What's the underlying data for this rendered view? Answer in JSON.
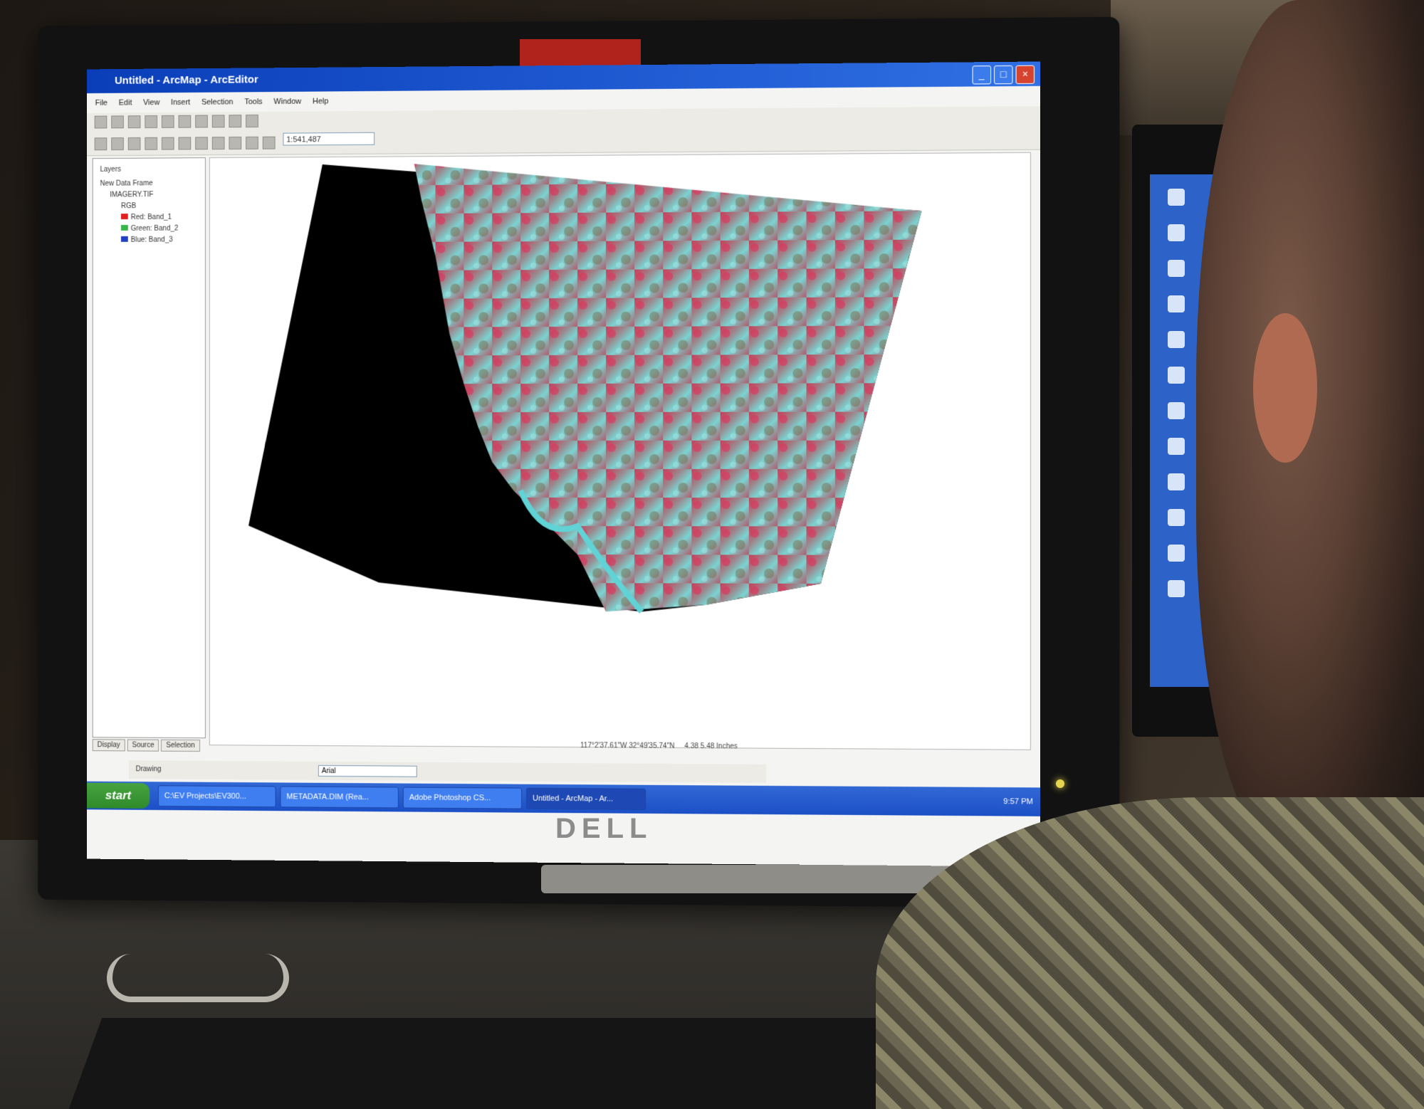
{
  "window": {
    "title": "Untitled - ArcMap - ArcEditor",
    "buttons": [
      "_",
      "□",
      "×"
    ]
  },
  "menu": [
    "File",
    "Edit",
    "View",
    "Insert",
    "Selection",
    "Tools",
    "Window",
    "Help"
  ],
  "toolbar": {
    "scale": "1:541,487"
  },
  "toc": {
    "root": "Layers",
    "frame": "New Data Frame",
    "layer": "IMAGERY.TIF",
    "rgb_label": "RGB",
    "bands": [
      {
        "label": "Red: Band_1",
        "color": "#e02020"
      },
      {
        "label": "Green: Band_2",
        "color": "#39b54a"
      },
      {
        "label": "Blue: Band_3",
        "color": "#2040c0"
      }
    ],
    "tabs": [
      "Display",
      "Source",
      "Selection"
    ]
  },
  "status": {
    "coords": "117°2'37.61\"W 32°49'35.74\"N",
    "page": "4.38 5.48 Inches"
  },
  "drawing": {
    "label": "Drawing",
    "font": "Arial",
    "size": "10"
  },
  "taskbar": {
    "start": "start",
    "items": [
      "C:\\EV Projects\\EV300...",
      "METADATA.DIM (Rea...",
      "Adobe Photoshop CS...",
      "Untitled - ArcMap - Ar..."
    ],
    "clock": "9:57 PM"
  },
  "brand": "DELL",
  "colors": {
    "xp_blue": "#2458d0",
    "start_green": "#3a9a33",
    "ocean": "#000000",
    "vegetation": "#d8324f",
    "urban": "#7fd8d6"
  }
}
